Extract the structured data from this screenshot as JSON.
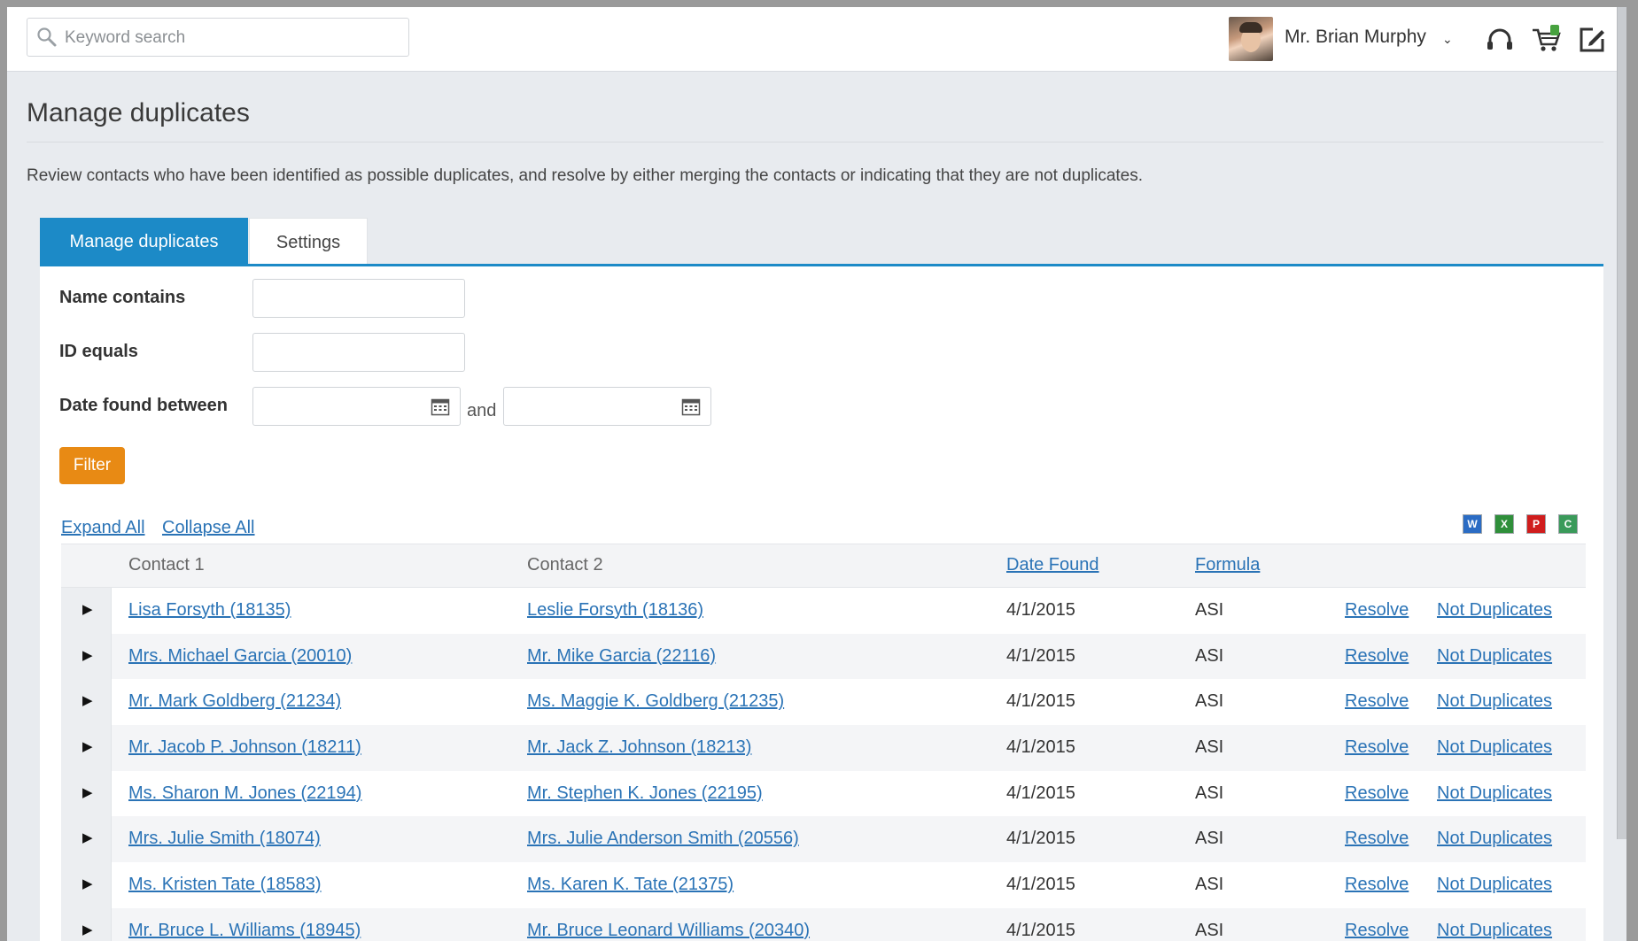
{
  "header": {
    "search_placeholder": "Keyword search",
    "user_name": "Mr. Brian Murphy",
    "caret": "⌄"
  },
  "page": {
    "title": "Manage duplicates",
    "description": "Review contacts who have been identified as possible duplicates, and resolve by either merging the contacts or indicating that they are not duplicates."
  },
  "tabs": [
    {
      "label": "Manage duplicates",
      "active": true
    },
    {
      "label": "Settings",
      "active": false
    }
  ],
  "filters": {
    "name_label": "Name contains",
    "name_value": "",
    "id_label": "ID equals",
    "id_value": "",
    "date_label": "Date found between",
    "date_from": "",
    "and_label": "and",
    "date_to": "",
    "filter_button": "Filter"
  },
  "grid_actions": {
    "expand_all": "Expand All",
    "collapse_all": "Collapse All"
  },
  "export_icons": [
    "word-export-icon",
    "excel-export-icon",
    "pdf-export-icon",
    "csv-export-icon"
  ],
  "columns": {
    "contact1": "Contact 1",
    "contact2": "Contact 2",
    "date_found": "Date Found",
    "formula": "Formula"
  },
  "rows": [
    {
      "contact1": "Lisa Forsyth (18135)",
      "contact2": "Leslie Forsyth (18136)",
      "date": "4/1/2015",
      "formula": "ASI",
      "resolve": "Resolve",
      "not_dup": "Not Duplicates"
    },
    {
      "contact1": "Mrs. Michael Garcia (20010)",
      "contact2": "Mr. Mike Garcia (22116)",
      "date": "4/1/2015",
      "formula": "ASI",
      "resolve": "Resolve",
      "not_dup": "Not Duplicates"
    },
    {
      "contact1": "Mr. Mark Goldberg (21234)",
      "contact2": "Ms. Maggie K. Goldberg (21235)",
      "date": "4/1/2015",
      "formula": "ASI",
      "resolve": "Resolve",
      "not_dup": "Not Duplicates"
    },
    {
      "contact1": "Mr. Jacob P. Johnson (18211)",
      "contact2": "Mr. Jack Z. Johnson (18213)",
      "date": "4/1/2015",
      "formula": "ASI",
      "resolve": "Resolve",
      "not_dup": "Not Duplicates"
    },
    {
      "contact1": "Ms. Sharon M. Jones (22194)",
      "contact2": "Mr. Stephen K. Jones (22195)",
      "date": "4/1/2015",
      "formula": "ASI",
      "resolve": "Resolve",
      "not_dup": "Not Duplicates"
    },
    {
      "contact1": "Mrs. Julie Smith (18074)",
      "contact2": "Mrs. Julie Anderson Smith (20556)",
      "date": "4/1/2015",
      "formula": "ASI",
      "resolve": "Resolve",
      "not_dup": "Not Duplicates"
    },
    {
      "contact1": "Ms. Kristen Tate (18583)",
      "contact2": "Ms. Karen K. Tate (21375)",
      "date": "4/1/2015",
      "formula": "ASI",
      "resolve": "Resolve",
      "not_dup": "Not Duplicates"
    },
    {
      "contact1": "Mr. Bruce L. Williams (18945)",
      "contact2": "Mr. Bruce Leonard Williams (20340)",
      "date": "4/1/2015",
      "formula": "ASI",
      "resolve": "Resolve",
      "not_dup": "Not Duplicates"
    }
  ],
  "colors": {
    "accent": "#1c8ac7",
    "filter_button": "#e88a14",
    "link": "#2a73b6"
  }
}
